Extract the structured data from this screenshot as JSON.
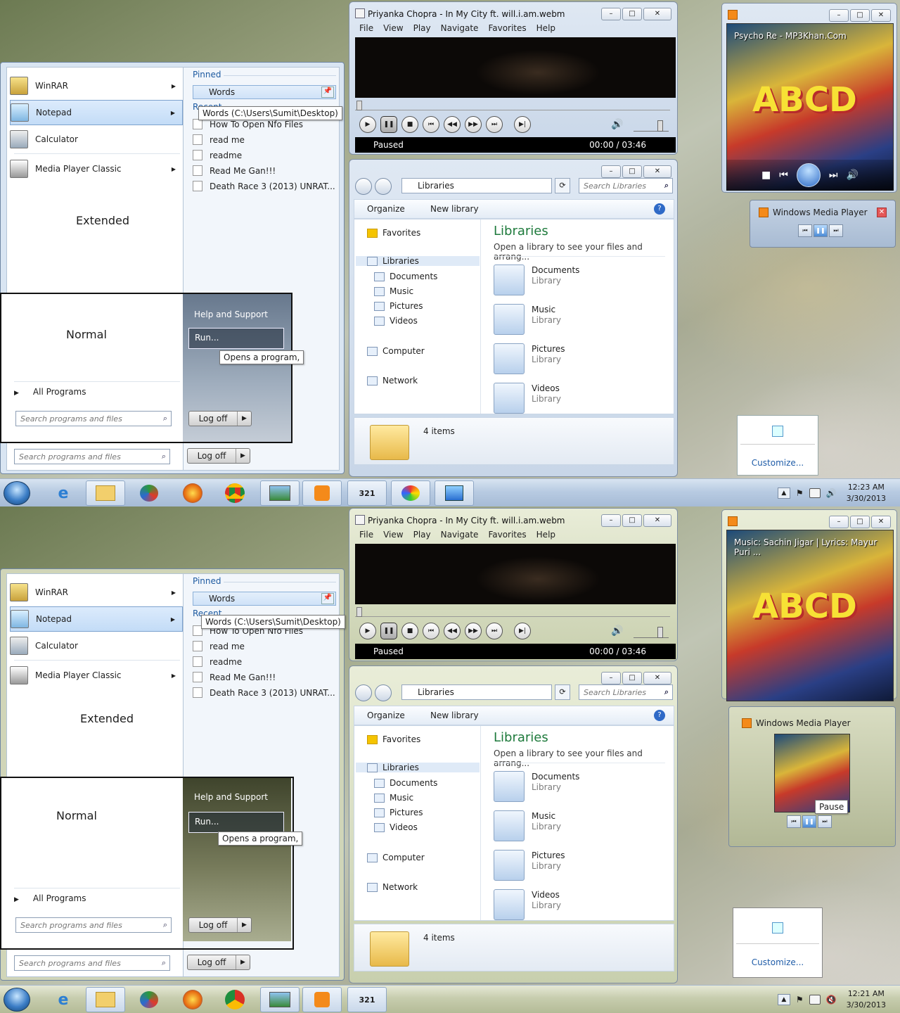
{
  "colors": {
    "accent": "#1e7a3c",
    "link": "#1f5ca8",
    "pinned": "#1d5aa0"
  },
  "startmenu": {
    "programs": [
      "WinRAR",
      "Notepad",
      "Calculator",
      "Media Player Classic"
    ],
    "pinned_header": "Pinned",
    "recent_header": "Recent",
    "pinned_item": "Words",
    "tooltip": "Words (C:\\Users\\Sumit\\Desktop)",
    "recent": [
      "How To Open Nfo Files",
      "read me",
      "readme",
      "Read Me Gan!!!",
      "Death Race 3 (2013) UNRAT..."
    ],
    "extended": "Extended",
    "normal": "Normal",
    "help": "Help and Support",
    "run": "Run...",
    "run_tip": "Opens a program,",
    "all_programs": "All Programs",
    "search_placeholder": "Search programs and files",
    "logoff": "Log off"
  },
  "mpc": {
    "title": "Priyanka Chopra - In My City ft. will.i.am.webm",
    "menu": [
      "File",
      "View",
      "Play",
      "Navigate",
      "Favorites",
      "Help"
    ],
    "status": "Paused",
    "time": "00:00 / 03:46"
  },
  "explorer": {
    "address": "Libraries",
    "search": "Search Libraries",
    "organize": "Organize",
    "newlib": "New library",
    "nav": [
      "Favorites",
      "Libraries",
      "Documents",
      "Music",
      "Pictures",
      "Videos",
      "Computer",
      "Network"
    ],
    "heading": "Libraries",
    "subheading": "Open a library to see your files and arrang...",
    "libs": [
      {
        "name": "Documents",
        "type": "Library"
      },
      {
        "name": "Music",
        "type": "Library"
      },
      {
        "name": "Pictures",
        "type": "Library"
      },
      {
        "name": "Videos",
        "type": "Library"
      }
    ],
    "count": "4 items"
  },
  "wmp": {
    "top_title": "Psycho Re - MP3Khan.Com",
    "bottom_title": "Music: Sachin Jigar | Lyrics: Mayur Puri ...",
    "album": "ABCD",
    "mini_title": "Windows Media Player",
    "thumb_tip": "Pause"
  },
  "tray": {
    "customize": "Customize...",
    "top_time": "12:23 AM",
    "top_date": "3/30/2013",
    "bottom_time": "12:21 AM",
    "bottom_date": "3/30/2013"
  }
}
